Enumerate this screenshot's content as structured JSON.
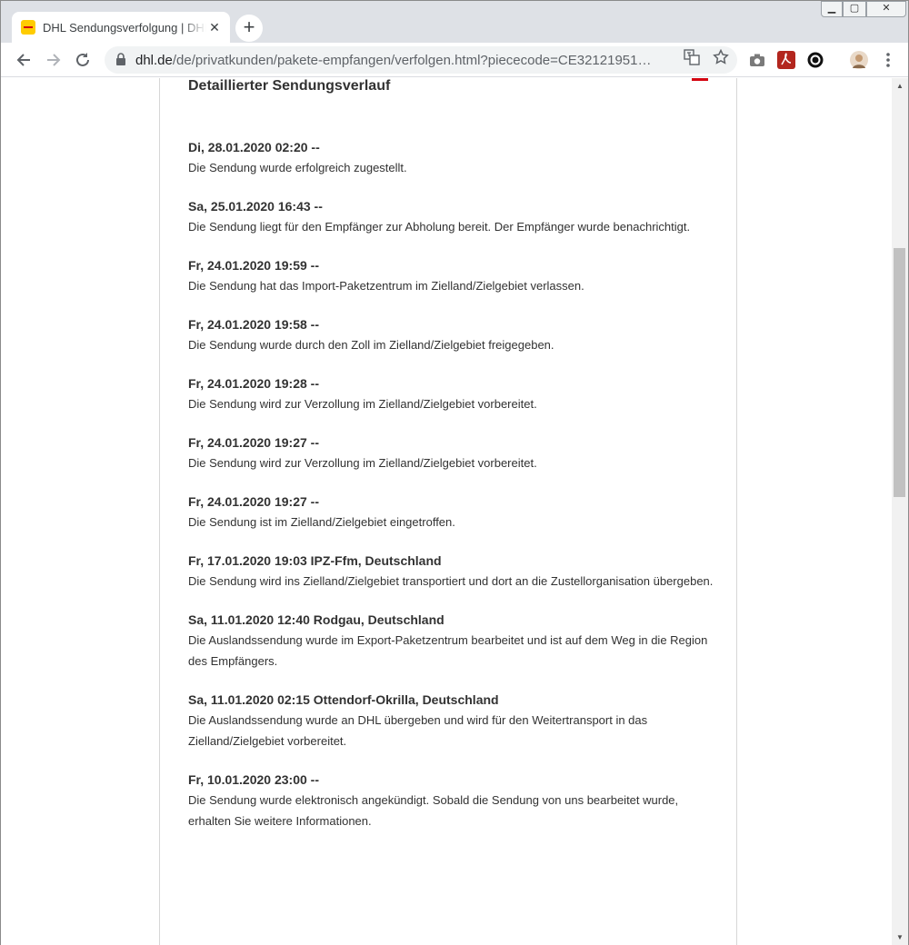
{
  "browser": {
    "tab_title": "DHL Sendungsverfolgung | DHL",
    "tab_close": "✕",
    "new_tab": "+",
    "url_domain": "dhl.de",
    "url_path": "/de/privatkunden/pakete-empfangen/verfolgen.html?piececode=CE32121951…",
    "window_min": "▁",
    "window_max": "▢",
    "window_close": "✕"
  },
  "page": {
    "section_title": "Detaillierter Sendungsverlauf",
    "events": [
      {
        "title": "Di, 28.01.2020 02:20 --",
        "desc": "Die Sendung wurde erfolgreich zugestellt."
      },
      {
        "title": "Sa, 25.01.2020 16:43 --",
        "desc": "Die Sendung liegt für den Empfänger zur Abholung bereit. Der Empfänger wurde benachrichtigt."
      },
      {
        "title": "Fr, 24.01.2020 19:59 --",
        "desc": "Die Sendung hat das Import-Paketzentrum im Zielland/Zielgebiet verlassen."
      },
      {
        "title": "Fr, 24.01.2020 19:58 --",
        "desc": "Die Sendung wurde durch den Zoll im Zielland/Zielgebiet freigegeben."
      },
      {
        "title": "Fr, 24.01.2020 19:28 --",
        "desc": "Die Sendung wird zur Verzollung im Zielland/Zielgebiet vorbereitet."
      },
      {
        "title": "Fr, 24.01.2020 19:27 --",
        "desc": "Die Sendung wird zur Verzollung im Zielland/Zielgebiet vorbereitet."
      },
      {
        "title": "Fr, 24.01.2020 19:27 --",
        "desc": "Die Sendung ist im Zielland/Zielgebiet eingetroffen."
      },
      {
        "title": "Fr, 17.01.2020 19:03 IPZ-Ffm, Deutschland",
        "desc": "Die Sendung wird ins Zielland/Zielgebiet transportiert und dort an die Zustellorganisation übergeben."
      },
      {
        "title": "Sa, 11.01.2020 12:40 Rodgau, Deutschland",
        "desc": "Die Auslandssendung wurde im Export-Paketzentrum bearbeitet und ist auf dem Weg in die Region des Empfängers."
      },
      {
        "title": "Sa, 11.01.2020 02:15 Ottendorf-Okrilla, Deutschland",
        "desc": "Die Auslandssendung wurde an DHL übergeben und wird für den Weitertransport in das Zielland/Zielgebiet vorbereitet."
      },
      {
        "title": "Fr, 10.01.2020 23:00 --",
        "desc": "Die Sendung wurde elektronisch angekündigt. Sobald die Sendung von uns bearbeitet wurde, erhalten Sie weitere Informationen."
      }
    ]
  },
  "colors": {
    "dhl_red": "#d40511",
    "dhl_yellow": "#ffcc00",
    "text": "#323232"
  }
}
